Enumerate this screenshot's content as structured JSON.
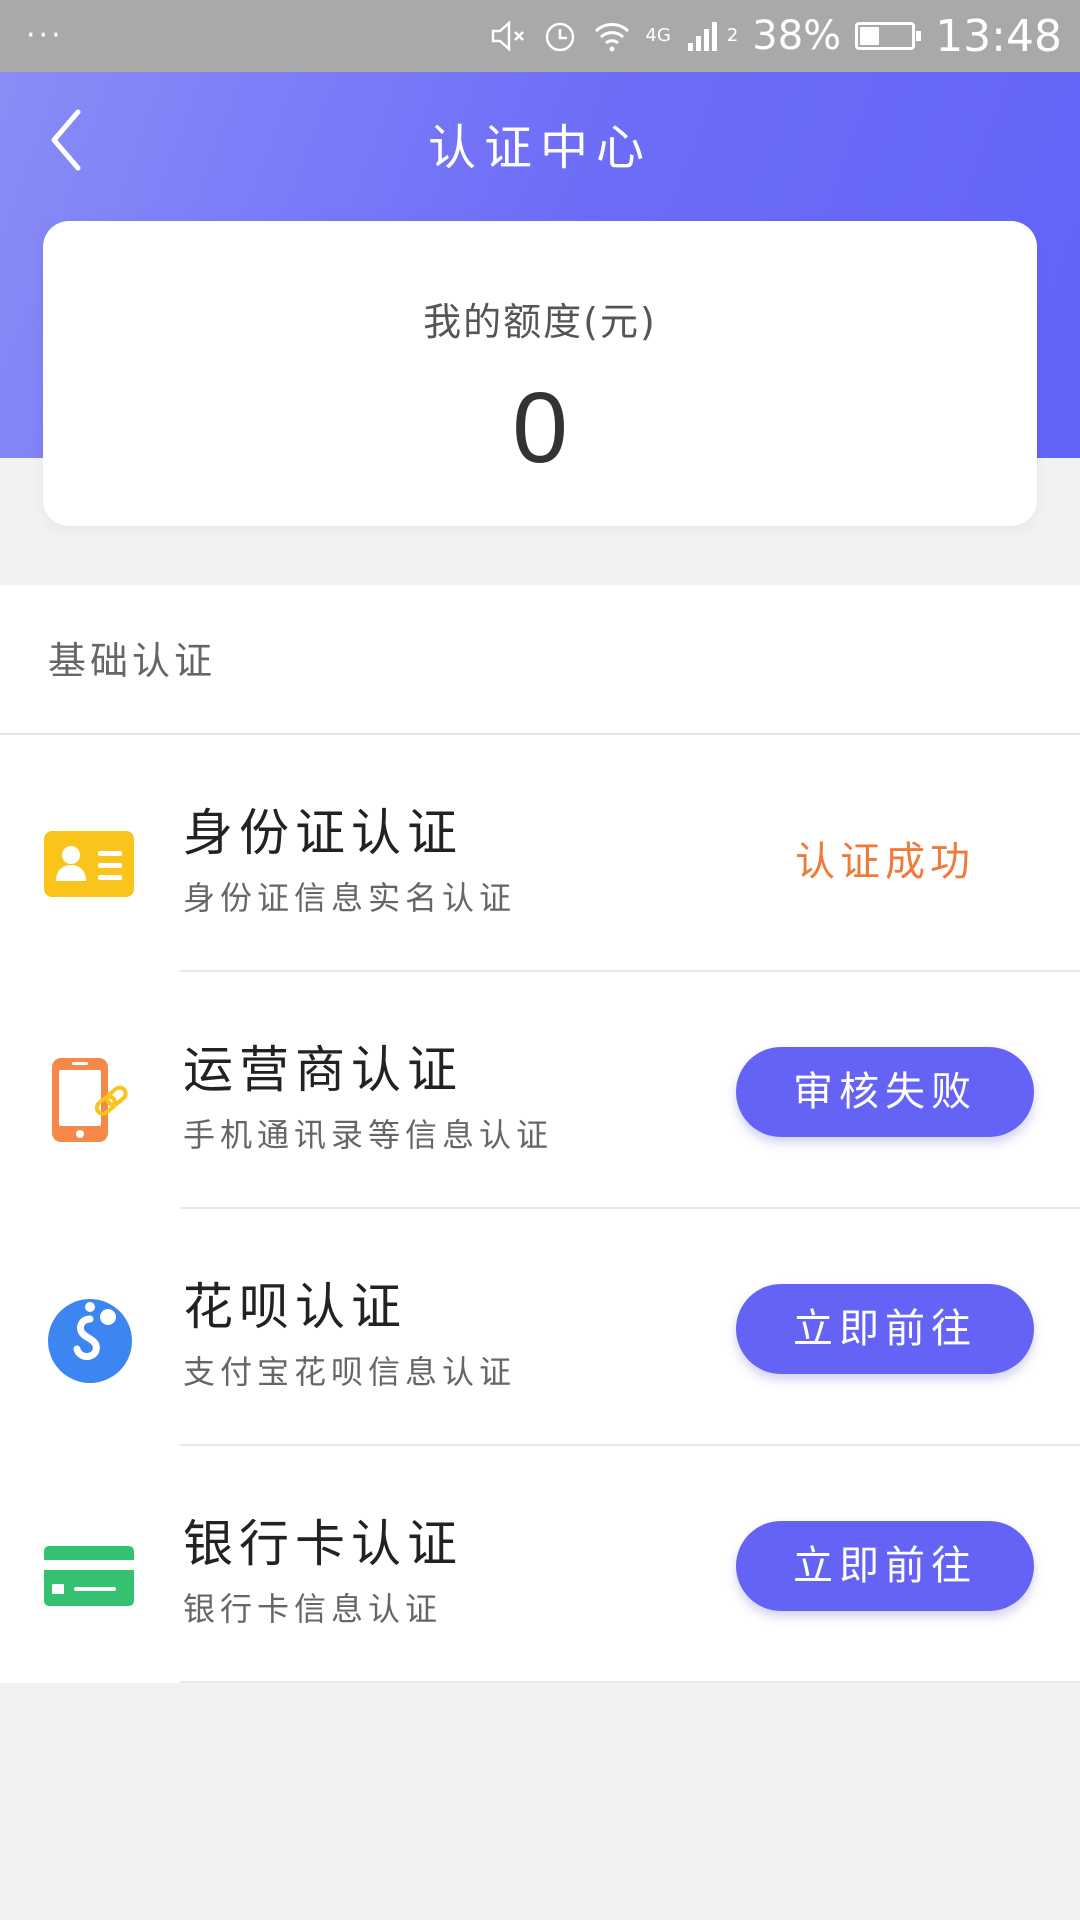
{
  "status_bar": {
    "left": "···",
    "network": "4G",
    "sim": "2",
    "battery_percent": "38%",
    "battery_level": 0.38,
    "time": "13:48"
  },
  "header": {
    "title": "认证中心",
    "back_icon": "chevron-left-icon",
    "gradient_start": "#8a8cf7",
    "gradient_end": "#6363f9"
  },
  "quota": {
    "label": "我的额度(元)",
    "value": "0"
  },
  "section": {
    "title": "基础认证",
    "items": [
      {
        "title": "身份证认证",
        "subtitle": "身份证信息实名认证",
        "icon": "id-card-icon",
        "status": "认证成功",
        "status_color": "#f07a3a"
      },
      {
        "title": "运营商认证",
        "subtitle": "手机通讯录等信息认证",
        "icon": "mobile-phone-icon",
        "button": "审核失败"
      },
      {
        "title": "花呗认证",
        "subtitle": "支付宝花呗信息认证",
        "icon": "huabei-icon",
        "button": "立即前往"
      },
      {
        "title": "银行卡认证",
        "subtitle": "银行卡信息认证",
        "icon": "bank-card-icon",
        "button": "立即前往"
      }
    ]
  },
  "colors": {
    "accent": "#6563f6",
    "success_text": "#f07a3a",
    "page_bg": "#f2f2f2"
  }
}
